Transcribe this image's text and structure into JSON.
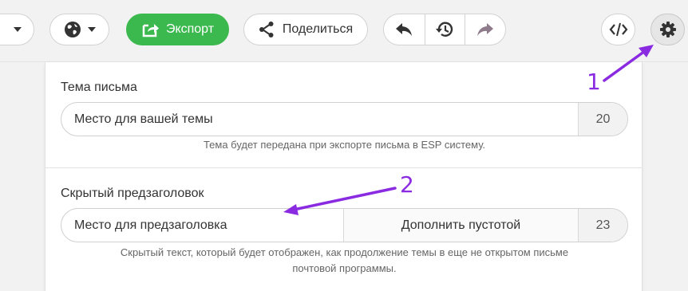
{
  "toolbar": {
    "export_label": "Экспорт",
    "share_label": "Поделиться"
  },
  "subject": {
    "label": "Тема письма",
    "placeholder": "Место для вашей темы",
    "count": "20",
    "hint": "Тема будет передана при экспорте письма в ESP систему."
  },
  "preheader": {
    "label": "Скрытый предзаголовок",
    "placeholder": "Место для предзаголовка",
    "fill_label": "Дополнить пустотой",
    "count": "23",
    "hint_line1": "Скрытый текст, который будет отображен, как продолжение темы в еще не открытом письме",
    "hint_line2": "почтовой программы."
  },
  "annotations": {
    "marker_1": "1",
    "marker_2": "2"
  },
  "colors": {
    "export_green": "#3cb94e",
    "annotation_purple": "#8a2be2"
  }
}
